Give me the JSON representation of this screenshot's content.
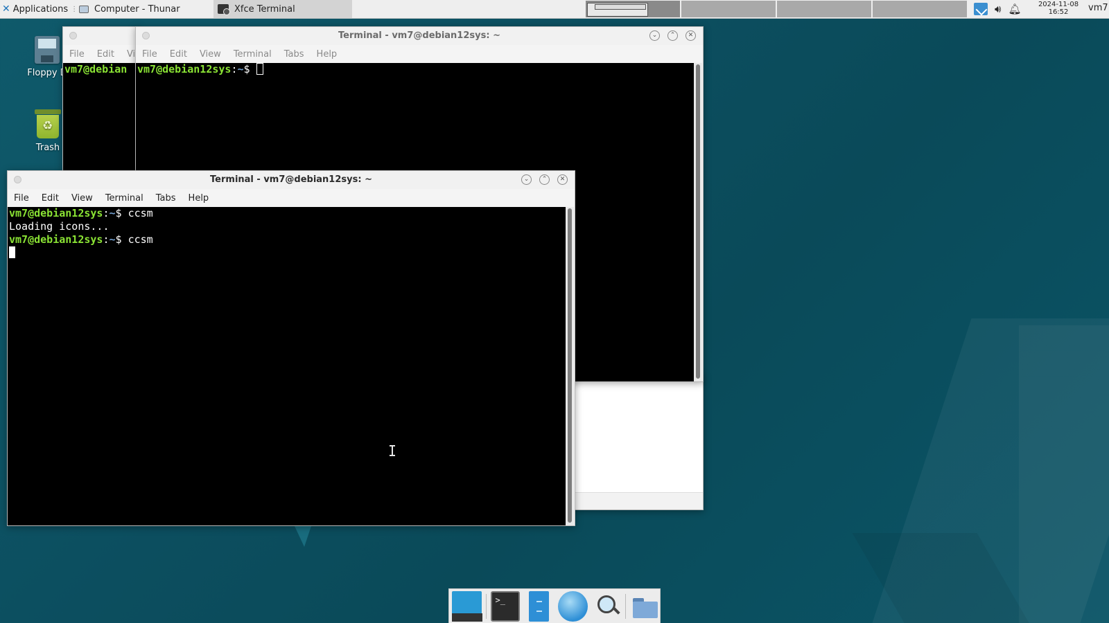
{
  "panel": {
    "applications_label": "Applications",
    "tasks": [
      {
        "label": "Computer - Thunar"
      },
      {
        "label": "Xfce Terminal"
      }
    ],
    "clock_date": "2024-11-08",
    "clock_time": "16:52",
    "user": "vm7"
  },
  "desktop": {
    "icons": [
      {
        "label": "Floppy D"
      },
      {
        "label": "Trash"
      }
    ]
  },
  "back_window_left": {
    "menu": [
      "File",
      "Edit",
      "Vi"
    ],
    "prompt_user": "vm7@debian"
  },
  "back_terminal": {
    "title": "Terminal - vm7@debian12sys: ~",
    "menu": [
      "File",
      "Edit",
      "View",
      "Terminal",
      "Tabs",
      "Help"
    ],
    "prompt_user": "vm7@debian12sys",
    "prompt_sep": ":",
    "prompt_dir": "~",
    "prompt_sym": "$ "
  },
  "front_terminal": {
    "title": "Terminal - vm7@debian12sys: ~",
    "menu": [
      "File",
      "Edit",
      "View",
      "Terminal",
      "Tabs",
      "Help"
    ],
    "lines": [
      {
        "user": "vm7@debian12sys",
        "sep": ":",
        "dir": "~",
        "sym": "$ ",
        "cmd": "ccsm"
      },
      {
        "output": "Loading icons..."
      },
      {
        "user": "vm7@debian12sys",
        "sep": ":",
        "dir": "~",
        "sym": "$ ",
        "cmd": "ccsm"
      }
    ]
  },
  "dock": {
    "items": [
      "show-desktop",
      "terminal",
      "file-manager",
      "web-browser",
      "app-finder",
      "folder"
    ]
  }
}
